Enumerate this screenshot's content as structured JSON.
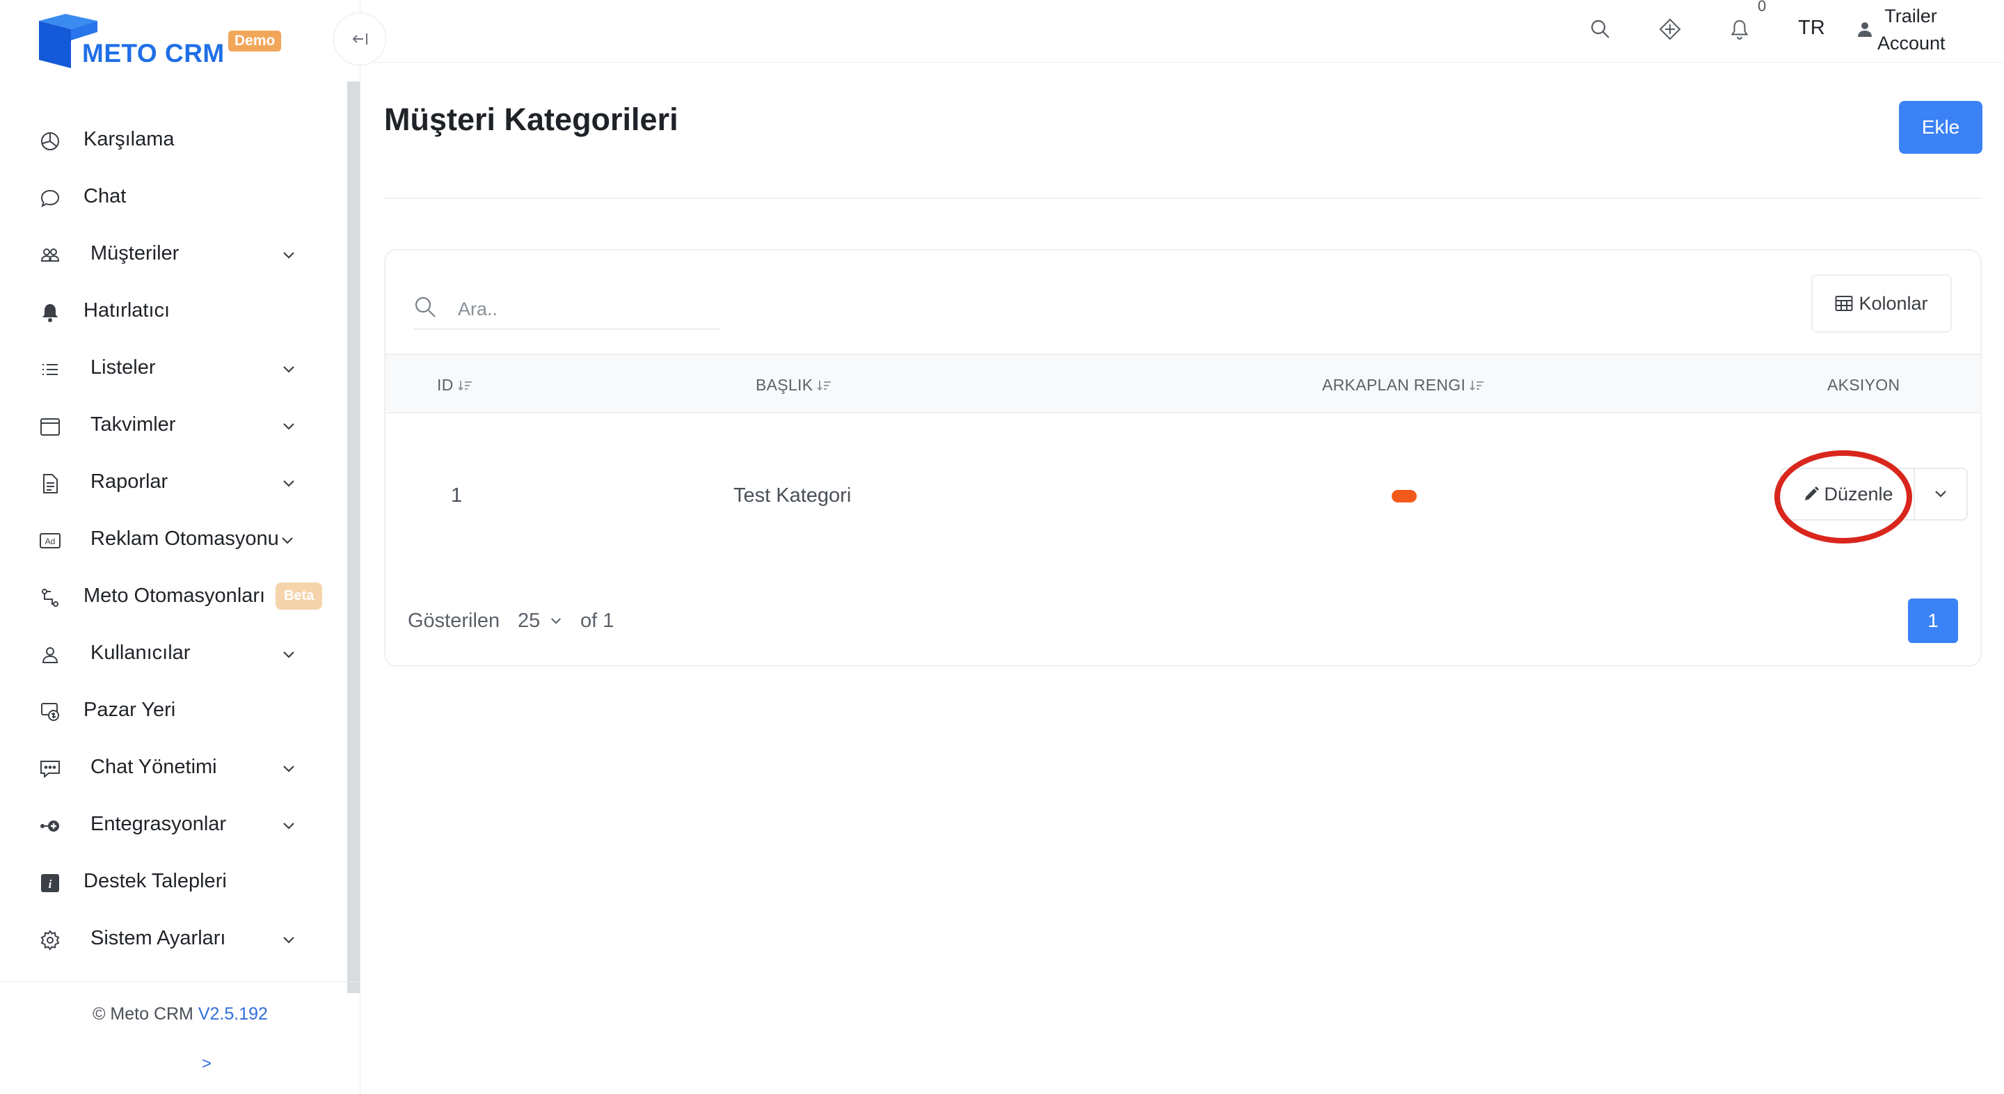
{
  "app": {
    "brand": "METO CRM",
    "badge": "Demo"
  },
  "sidebar": {
    "items": [
      {
        "label": "Karşılama",
        "icon": "dashboard-icon",
        "has_children": false
      },
      {
        "label": "Chat",
        "icon": "chat-bubble-icon",
        "has_children": false
      },
      {
        "label": "Müşteriler",
        "icon": "users-icon",
        "has_children": true
      },
      {
        "label": "Hatırlatıcı",
        "icon": "bell-icon",
        "has_children": false
      },
      {
        "label": "Listeler",
        "icon": "list-icon",
        "has_children": true
      },
      {
        "label": "Takvimler",
        "icon": "calendar-icon",
        "has_children": true
      },
      {
        "label": "Raporlar",
        "icon": "document-icon",
        "has_children": true
      },
      {
        "label": "Reklam Otomasyonu",
        "icon": "ad-icon",
        "has_children": true
      },
      {
        "label": "Meto Otomasyonları",
        "icon": "workflow-icon",
        "has_children": false,
        "badge": "Beta"
      },
      {
        "label": "Kullanıcılar",
        "icon": "user-icon",
        "has_children": true
      },
      {
        "label": "Pazar Yeri",
        "icon": "marketplace-icon",
        "has_children": false
      },
      {
        "label": "Chat Yönetimi",
        "icon": "chat-settings-icon",
        "has_children": true
      },
      {
        "label": "Entegrasyonlar",
        "icon": "integration-icon",
        "has_children": true
      },
      {
        "label": "Destek Talepleri",
        "icon": "info-icon",
        "has_children": false
      },
      {
        "label": "Sistem Ayarları",
        "icon": "gear-icon",
        "has_children": true
      }
    ],
    "footer": {
      "copyright": "© Meto CRM",
      "version": "V2.5.192",
      "expand": ">"
    }
  },
  "header": {
    "notification_count": "0",
    "language": "TR",
    "account_line1": "Trailer",
    "account_line2": "Account"
  },
  "page": {
    "title": "Müşteri Kategorileri",
    "add_button": "Ekle"
  },
  "table": {
    "search_placeholder": "Ara..",
    "columns_button": "Kolonlar",
    "headers": {
      "id": "ID",
      "title": "BAŞLIK",
      "bg_color": "ARKAPLAN RENGI",
      "action": "AKSIYON"
    },
    "rows": [
      {
        "id": "1",
        "title": "Test Kategori",
        "bg_color": "#f25a1b",
        "action_label": "Düzenle"
      }
    ],
    "pagination": {
      "shown_label": "Gösterilen",
      "page_size": "25",
      "of_label": "of 1",
      "current_page": "1"
    }
  },
  "colors": {
    "primary": "#3b82f6",
    "brand": "#1f6fe6",
    "highlight_ring": "#d9261c",
    "beta_badge": "#f5d3ab",
    "demo_badge": "#f2a65a"
  }
}
